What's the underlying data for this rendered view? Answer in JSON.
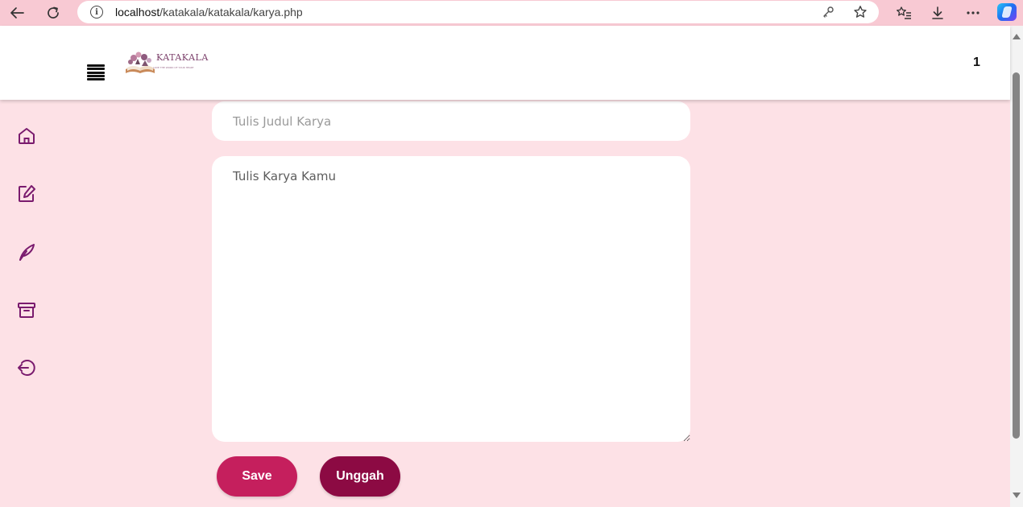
{
  "browser": {
    "url_host": "localhost",
    "url_path": "/katakala/katakala/karya.php"
  },
  "header": {
    "logo_text": "KATAKALA",
    "logo_tagline": "LOVE THE WORD OF YOUR HEART",
    "count": "1"
  },
  "sidebar": {
    "items": [
      {
        "icon": "home-icon"
      },
      {
        "icon": "edit-icon"
      },
      {
        "icon": "feather-icon"
      },
      {
        "icon": "archive-icon"
      },
      {
        "icon": "logout-icon"
      }
    ]
  },
  "form": {
    "title_placeholder": "Tulis Judul Karya",
    "body_placeholder": "Tulis Karya Kamu",
    "save_label": "Save",
    "upload_label": "Unggah"
  },
  "colors": {
    "page_bg": "#fde1e6",
    "accent_icon": "#7a1b6e",
    "save_button": "#c51f5d",
    "upload_button": "#8c0a43",
    "browser_bar": "#f8c9d3"
  }
}
